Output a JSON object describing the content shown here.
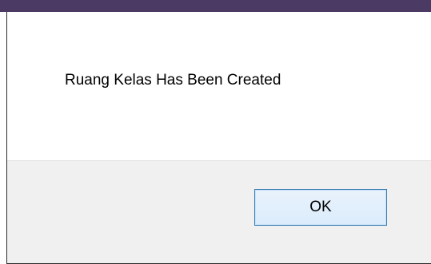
{
  "dialog": {
    "message": "Ruang Kelas Has Been Created",
    "ok_label": "OK"
  },
  "colors": {
    "window_strip": "#4b3a63",
    "button_border": "#3c7fb1",
    "button_bar": "#f0f0f0"
  }
}
